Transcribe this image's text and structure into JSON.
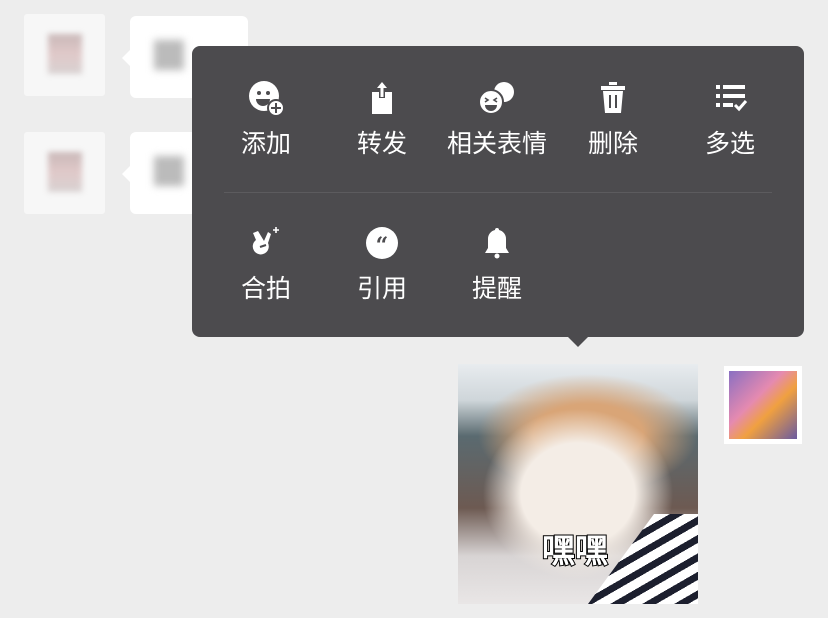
{
  "menu": {
    "row1": [
      {
        "label": "添加",
        "icon": "emoji-add-icon"
      },
      {
        "label": "转发",
        "icon": "share-icon"
      },
      {
        "label": "相关表情",
        "icon": "related-emoji-icon"
      },
      {
        "label": "删除",
        "icon": "trash-icon"
      },
      {
        "label": "多选",
        "icon": "multi-select-icon"
      }
    ],
    "row2": [
      {
        "label": "合拍",
        "icon": "co-shoot-icon"
      },
      {
        "label": "引用",
        "icon": "quote-icon"
      },
      {
        "label": "提醒",
        "icon": "bell-icon"
      }
    ]
  },
  "sticker": {
    "caption": "嘿嘿"
  },
  "colors": {
    "menu_bg": "#4c4b4e",
    "page_bg": "#ededed"
  }
}
